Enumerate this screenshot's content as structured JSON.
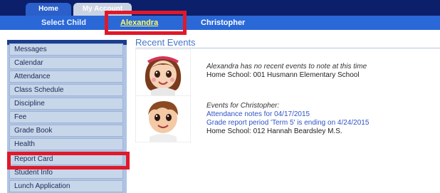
{
  "tabs": [
    {
      "label": "Home"
    },
    {
      "label": "My Account"
    }
  ],
  "child_bar": {
    "select_label": "Select Child",
    "children": [
      "Alexandra",
      "Christopher"
    ]
  },
  "sidebar": {
    "items": [
      {
        "label": "Messages"
      },
      {
        "label": "Calendar"
      },
      {
        "label": "Attendance"
      },
      {
        "label": "Class Schedule"
      },
      {
        "label": "Discipline"
      },
      {
        "label": "Fee"
      },
      {
        "label": "Grade Book"
      },
      {
        "label": "Health"
      },
      {
        "label": "Report Card"
      },
      {
        "label": "Student Info"
      },
      {
        "label": "Lunch Application"
      }
    ]
  },
  "main": {
    "title": "Recent Events",
    "events": [
      {
        "line1": "Alexandra has no recent events to note at this time",
        "line2": "Home School: 001 Husmann Elementary School"
      },
      {
        "line1": "Events for Christopher:",
        "link1": "Attendance notes for 04/17/2015",
        "link2": "Grade report period 'Term 5' is ending on 4/24/2015",
        "line2": "Home School: 012 Hannah Beardsley M.S."
      }
    ]
  },
  "colors": {
    "nav_dark": "#0c1f6b",
    "nav_blue": "#2a68d8",
    "highlight_red": "#e0192a",
    "selected_child": "#ffff6a"
  },
  "icons": [
    "girl-avatar-icon",
    "boy-avatar-icon"
  ]
}
